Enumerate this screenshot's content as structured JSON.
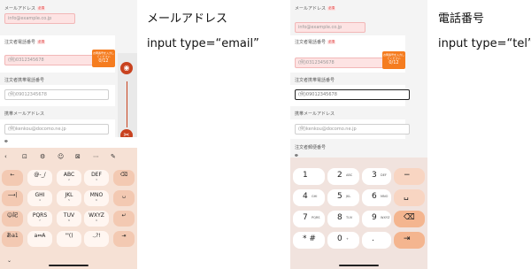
{
  "captions": {
    "left_title": "メールアドレス",
    "left_type": "input type=“email”",
    "right_title": "電話番号",
    "right_type": "input type=“tel”"
  },
  "form": {
    "email_label": "メールアドレス",
    "email_placeholder": "info@example.co.jp",
    "phone_label": "注文者電話番号",
    "phone_placeholder": "(例)0312345678",
    "mobile_label": "注文者携帯電話番号",
    "mobile_placeholder": "(例)09012345678",
    "mobile_email_label": "携帯メールアドレス",
    "mobile_email_placeholder": "(例)kenkou@docomo.ne.jp",
    "postal_label": "注文者郵便番号",
    "required_badge": "必須",
    "counter_note": "お問番号を入力してください",
    "counter": "0/12"
  },
  "left_keyboard": {
    "toolbar": [
      "‹",
      "⊡",
      "⚙",
      "☺",
      "⊠",
      "⋯",
      "✎"
    ],
    "rows": [
      [
        {
          "m": "←",
          "s": ""
        },
        {
          "m": "@-_/",
          "s": ""
        },
        {
          "m": "ABC",
          "s": "2"
        },
        {
          "m": "DEF",
          "s": "3"
        },
        {
          "m": "⌫",
          "s": ""
        }
      ],
      [
        {
          "m": "⟶|",
          "s": ""
        },
        {
          "m": "GHI",
          "s": "4"
        },
        {
          "m": "JKL",
          "s": "5"
        },
        {
          "m": "MNO",
          "s": "6"
        },
        {
          "m": "␣",
          "s": ""
        }
      ],
      [
        {
          "m": "☺記",
          "s": ""
        },
        {
          "m": "PQRS",
          "s": "7"
        },
        {
          "m": "TUV",
          "s": "8"
        },
        {
          "m": "WXYZ",
          "s": "9"
        },
        {
          "m": "↵",
          "s": ""
        }
      ],
      [
        {
          "m": "あa1",
          "s": ""
        },
        {
          "m": "a⇔A",
          "s": ""
        },
        {
          "m": "'\"()",
          "s": ""
        },
        {
          "m": ".,?!",
          "s": ""
        },
        {
          "m": "⇥",
          "s": ""
        }
      ]
    ]
  },
  "right_keyboard": {
    "rows": [
      [
        {
          "n": "1",
          "s": ""
        },
        {
          "n": "2",
          "s": "ABC"
        },
        {
          "n": "3",
          "s": "DEF"
        },
        {
          "n": "−",
          "s": ""
        }
      ],
      [
        {
          "n": "4",
          "s": "GHI"
        },
        {
          "n": "5",
          "s": "JKL"
        },
        {
          "n": "6",
          "s": "MNO"
        },
        {
          "n": "␣",
          "s": ""
        }
      ],
      [
        {
          "n": "7",
          "s": "PQRS"
        },
        {
          "n": "8",
          "s": "TUV"
        },
        {
          "n": "9",
          "s": "WXYZ"
        },
        {
          "n": "⌫",
          "s": ""
        }
      ],
      [
        {
          "n": "* #",
          "s": ""
        },
        {
          "n": "0",
          "s": "+"
        },
        {
          "n": ".",
          "s": ""
        },
        {
          "n": "⇥",
          "s": ""
        }
      ]
    ]
  },
  "colors": {
    "accent": "#f57c1f",
    "error_bg": "#fde3e3",
    "side_button": "#c8421f"
  }
}
